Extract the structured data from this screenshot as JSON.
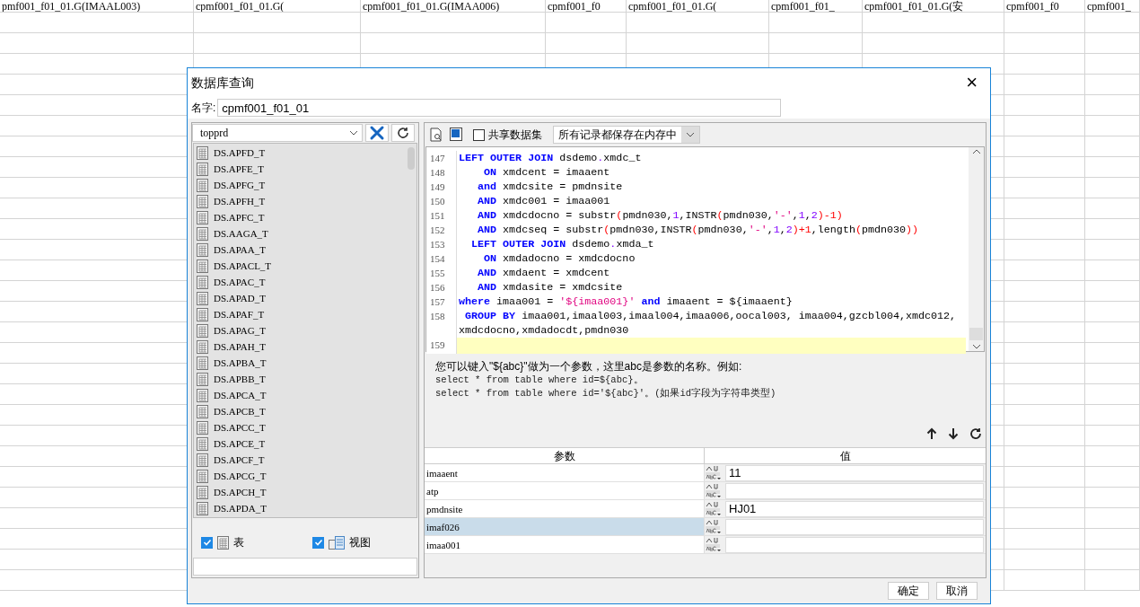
{
  "sheet": {
    "top_cells": [
      "pmf001_f01_01.G(IMAAL003)",
      "cpmf001_f01_01.G(",
      "cpmf001_f01_01.G(IMAA006)",
      "cpmf001_f0",
      "cpmf001_f01_01.G(",
      "cpmf001_f01_",
      "cpmf001_f01_01.G(安",
      "cpmf001_f0",
      "cpmf001_"
    ]
  },
  "dialog": {
    "title": "数据库查询",
    "close": "×",
    "name_label": "名字:",
    "name_value": "cpmf001_f01_01",
    "database": "topprd",
    "tables": [
      "DS.APFD_T",
      "DS.APFE_T",
      "DS.APFG_T",
      "DS.APFH_T",
      "DS.APFC_T",
      "DS.AAGA_T",
      "DS.APAA_T",
      "DS.APACL_T",
      "DS.APAC_T",
      "DS.APAD_T",
      "DS.APAF_T",
      "DS.APAG_T",
      "DS.APAH_T",
      "DS.APBA_T",
      "DS.APBB_T",
      "DS.APCA_T",
      "DS.APCB_T",
      "DS.APCC_T",
      "DS.APCE_T",
      "DS.APCF_T",
      "DS.APCG_T",
      "DS.APCH_T",
      "DS.APDA_T"
    ],
    "filters": [
      {
        "label": "表",
        "checked": true,
        "kind": "table"
      },
      {
        "label": "视图",
        "checked": true,
        "kind": "view"
      }
    ],
    "share_dataset": {
      "label": "共享数据集",
      "checked": false
    },
    "storage_mode": "所有记录都保存在内存中",
    "code_lines": [
      {
        "number": "147",
        "current": false,
        "segments": [
          {
            "kind": "kw",
            "text": "LEFT OUTER JOIN"
          },
          {
            "kind": "plain",
            "text": " dsdemo"
          },
          {
            "kind": "num",
            "text": "."
          },
          {
            "kind": "plain",
            "text": "xmdc_t"
          }
        ]
      },
      {
        "number": "148",
        "current": false,
        "segments": [
          {
            "kind": "kw",
            "text": "    ON"
          },
          {
            "kind": "plain",
            "text": " xmdcent = imaaent"
          }
        ]
      },
      {
        "number": "149",
        "current": false,
        "segments": [
          {
            "kind": "kw",
            "text": "   and"
          },
          {
            "kind": "plain",
            "text": " xmdcsite = pmdnsite"
          }
        ]
      },
      {
        "number": "150",
        "current": false,
        "segments": [
          {
            "kind": "kw",
            "text": "   AND"
          },
          {
            "kind": "plain",
            "text": " xmdc001 = imaa001"
          }
        ]
      },
      {
        "number": "151",
        "current": false,
        "segments": [
          {
            "kind": "kw",
            "text": "   AND"
          },
          {
            "kind": "plain",
            "text": " xmdcdocno = substr"
          },
          {
            "kind": "op",
            "text": "("
          },
          {
            "kind": "plain",
            "text": "pmdn030,"
          },
          {
            "kind": "num",
            "text": "1"
          },
          {
            "kind": "plain",
            "text": ",INSTR"
          },
          {
            "kind": "op",
            "text": "("
          },
          {
            "kind": "plain",
            "text": "pmdn030,"
          },
          {
            "kind": "str",
            "text": "'-'"
          },
          {
            "kind": "plain",
            "text": ","
          },
          {
            "kind": "num",
            "text": "1"
          },
          {
            "kind": "plain",
            "text": ","
          },
          {
            "kind": "num",
            "text": "2"
          },
          {
            "kind": "op",
            "text": ")-1)"
          }
        ]
      },
      {
        "number": "152",
        "current": false,
        "segments": [
          {
            "kind": "kw",
            "text": "   AND"
          },
          {
            "kind": "plain",
            "text": " xmdcseq = substr"
          },
          {
            "kind": "op",
            "text": "("
          },
          {
            "kind": "plain",
            "text": "pmdn030,INSTR"
          },
          {
            "kind": "op",
            "text": "("
          },
          {
            "kind": "plain",
            "text": "pmdn030,"
          },
          {
            "kind": "str",
            "text": "'-'"
          },
          {
            "kind": "plain",
            "text": ","
          },
          {
            "kind": "num",
            "text": "1"
          },
          {
            "kind": "plain",
            "text": ","
          },
          {
            "kind": "num",
            "text": "2"
          },
          {
            "kind": "op",
            "text": ")+1"
          },
          {
            "kind": "plain",
            "text": ",length"
          },
          {
            "kind": "op",
            "text": "("
          },
          {
            "kind": "plain",
            "text": "pmdn030"
          },
          {
            "kind": "op",
            "text": "))"
          }
        ]
      },
      {
        "number": "153",
        "current": false,
        "segments": [
          {
            "kind": "kw",
            "text": "  LEFT OUTER JOIN"
          },
          {
            "kind": "plain",
            "text": " dsdemo"
          },
          {
            "kind": "num",
            "text": "."
          },
          {
            "kind": "plain",
            "text": "xmda_t"
          }
        ]
      },
      {
        "number": "154",
        "current": false,
        "segments": [
          {
            "kind": "kw",
            "text": "    ON"
          },
          {
            "kind": "plain",
            "text": " xmdadocno = xmdcdocno"
          }
        ]
      },
      {
        "number": "155",
        "current": false,
        "segments": [
          {
            "kind": "kw",
            "text": "   AND"
          },
          {
            "kind": "plain",
            "text": " xmdaent = xmdcent"
          }
        ]
      },
      {
        "number": "156",
        "current": false,
        "segments": [
          {
            "kind": "kw",
            "text": "   AND"
          },
          {
            "kind": "plain",
            "text": " xmdasite = xmdcsite"
          }
        ]
      },
      {
        "number": "157",
        "current": false,
        "segments": [
          {
            "kind": "kw",
            "text": "where"
          },
          {
            "kind": "plain",
            "text": " imaa001 = "
          },
          {
            "kind": "str",
            "text": "'${imaa001}'"
          },
          {
            "kind": "kw",
            "text": " and"
          },
          {
            "kind": "plain",
            "text": " imaaent = ${imaaent}"
          }
        ]
      },
      {
        "number": "158",
        "current": false,
        "segments": [
          {
            "kind": "kw",
            "text": " GROUP BY"
          },
          {
            "kind": "plain",
            "text": " imaa001,imaal003,imaal004,imaa006,oocal003, imaa004,gzcbl004,xmdc012, xmdcdocno,xmdadocdt,pmdn030"
          }
        ]
      },
      {
        "number": "159",
        "current": true
      }
    ],
    "hint": [
      "您可以键入\"${abc}\"做为一个参数，这里abc是参数的名称。例如:",
      "select * from table where id=${abc}。",
      "select * from table where id='${abc}'。(如果id字段为字符串类型)"
    ],
    "param_columns": [
      "参数",
      "值"
    ],
    "params": [
      {
        "name": "imaaent",
        "value": "11",
        "selected": false
      },
      {
        "name": "atp",
        "selected": false
      },
      {
        "name": "pmdnsite",
        "value": "HJ01",
        "selected": false
      },
      {
        "name": "imaf026",
        "selected": true
      },
      {
        "name": "imaa001",
        "selected": false
      }
    ],
    "buttons": [
      "确定",
      "取消"
    ]
  }
}
